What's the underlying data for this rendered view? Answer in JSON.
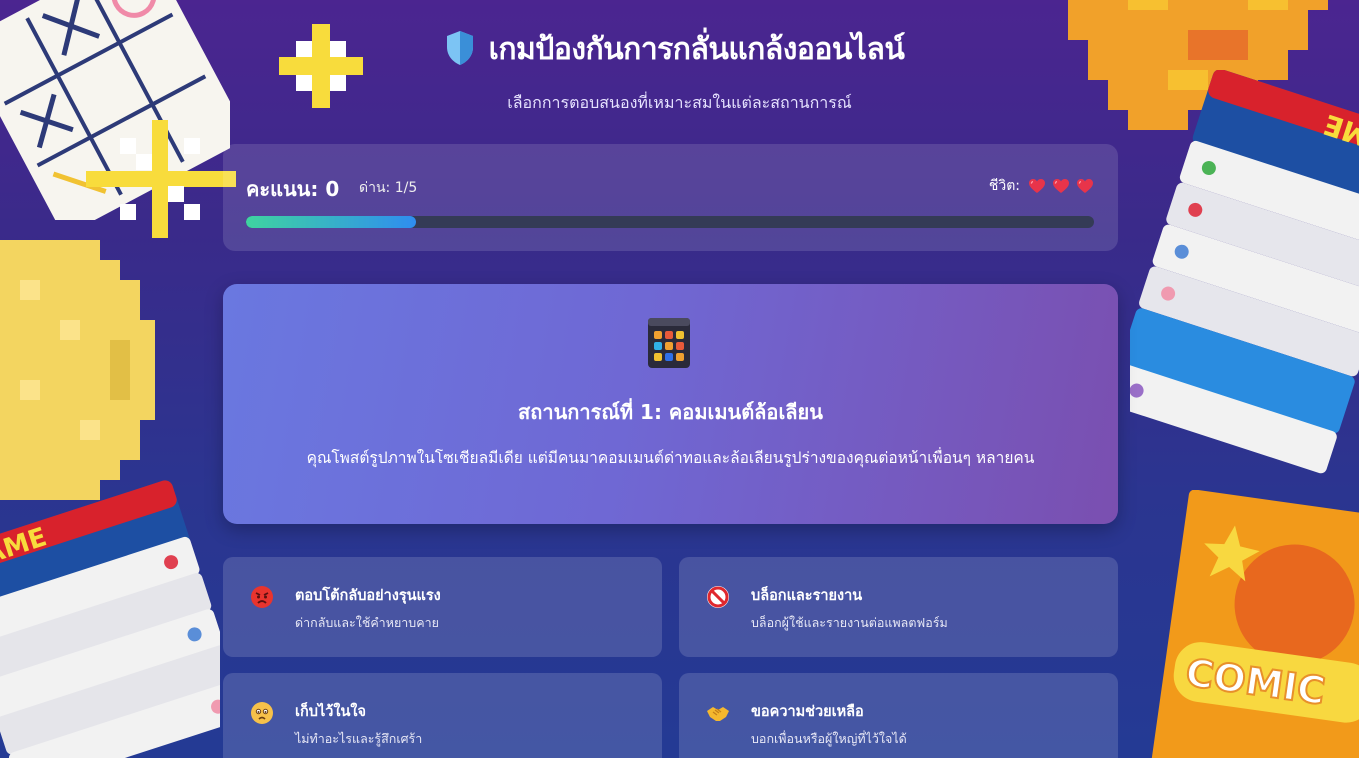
{
  "header": {
    "title": "เกมป้องกันการกลั่นแกล้งออนไลน์",
    "subtitle": "เลือกการตอบสนองที่เหมาะสมในแต่ละสถานการณ์"
  },
  "status": {
    "score_text": "คะแนน: 0",
    "level_text": "ด่าน: 1/5",
    "lives_label": "ชีวิต:",
    "lives": 3,
    "progress_fraction": 0.2
  },
  "scenario": {
    "icon": "app-grid-icon",
    "title": "สถานการณ์ที่ 1: คอมเมนต์ล้อเลียน",
    "description": "คุณโพสต์รูปภาพในโซเชียลมีเดีย แต่มีคนมาคอมเมนต์ด่าทอและล้อเลียนรูปร่างของคุณต่อหน้าเพื่อนๆ หลายคน"
  },
  "options": [
    {
      "icon": "angry-face-icon",
      "title": "ตอบโต้กลับอย่างรุนแรง",
      "desc": "ด่ากลับและใช้คำหยาบคาย"
    },
    {
      "icon": "prohibited-icon",
      "title": "บล็อกและรายงาน",
      "desc": "บล็อกผู้ใช้และรายงานต่อแพลตฟอร์ม"
    },
    {
      "icon": "sad-face-icon",
      "title": "เก็บไว้ในใจ",
      "desc": "ไม่ทำอะไรและรู้สึกเศร้า"
    },
    {
      "icon": "handshake-icon",
      "title": "ขอความช่วยเหลือ",
      "desc": "บอกเพื่อนหรือผู้ใหญ่ที่ไว้ใจได้"
    }
  ],
  "colors": {
    "background_top": "#4b2590",
    "background_bottom": "#243a94",
    "progress_start": "#3fd4a0",
    "progress_end": "#2f8df0",
    "heart": "#e8344a"
  },
  "decor": {
    "book_stack_left_text": "AME",
    "book_stack_right_text": "AME",
    "comic_text": "COMIC"
  }
}
